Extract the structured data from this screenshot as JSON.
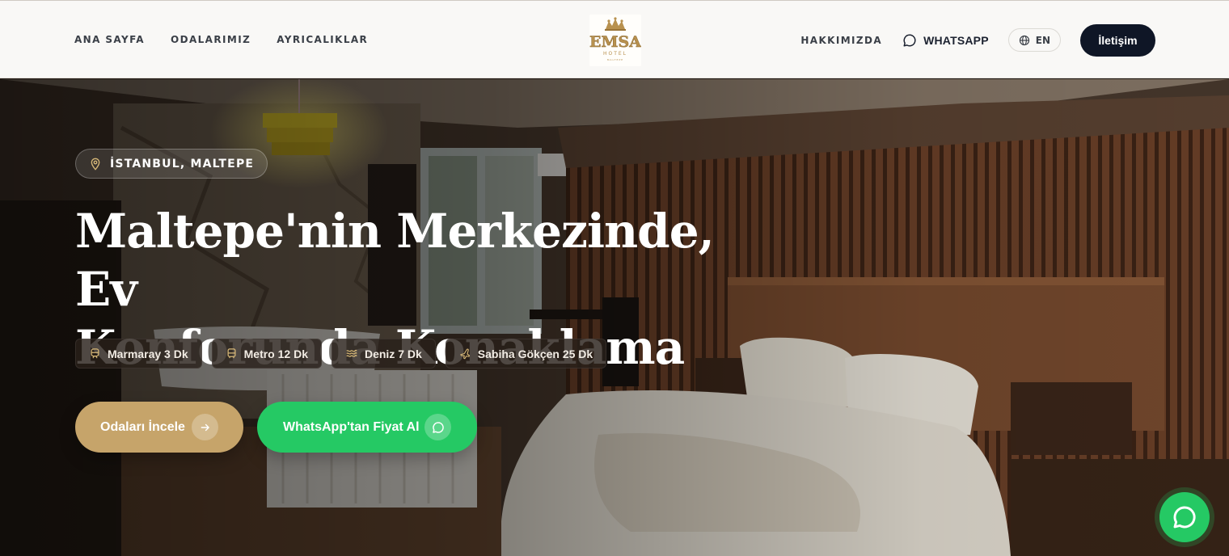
{
  "header": {
    "nav_left": [
      "ANA SAYFA",
      "ODALARIMIZ",
      "AYRICALIKLAR"
    ],
    "logo": {
      "text": "EMSA",
      "subtitle": "HOTEL",
      "tagline": "MALTEPE"
    },
    "nav_about": "HAKKIMIZDA",
    "whatsapp_label": "WHATSAPP",
    "language": "EN",
    "contact_label": "İletişim"
  },
  "hero": {
    "location": "İSTANBUL, MALTEPE",
    "title_line1": "Maltepe'nin Merkezinde, Ev",
    "title_line2": "Konforunda Konaklama",
    "chips": [
      {
        "icon": "train-icon",
        "label": "Marmaray 3 Dk"
      },
      {
        "icon": "bus-icon",
        "label": "Metro 12 Dk"
      },
      {
        "icon": "waves-icon",
        "label": "Deniz 7 Dk"
      },
      {
        "icon": "plane-icon",
        "label": "Sabiha Gökçen 25 Dk"
      }
    ],
    "primary_button": "Odaları İncele",
    "whatsapp_button": "WhatsApp'tan Fiyat Al"
  },
  "colors": {
    "navy": "#0f1626",
    "gold": "#c6a46a",
    "whatsapp_green": "#25c964"
  }
}
